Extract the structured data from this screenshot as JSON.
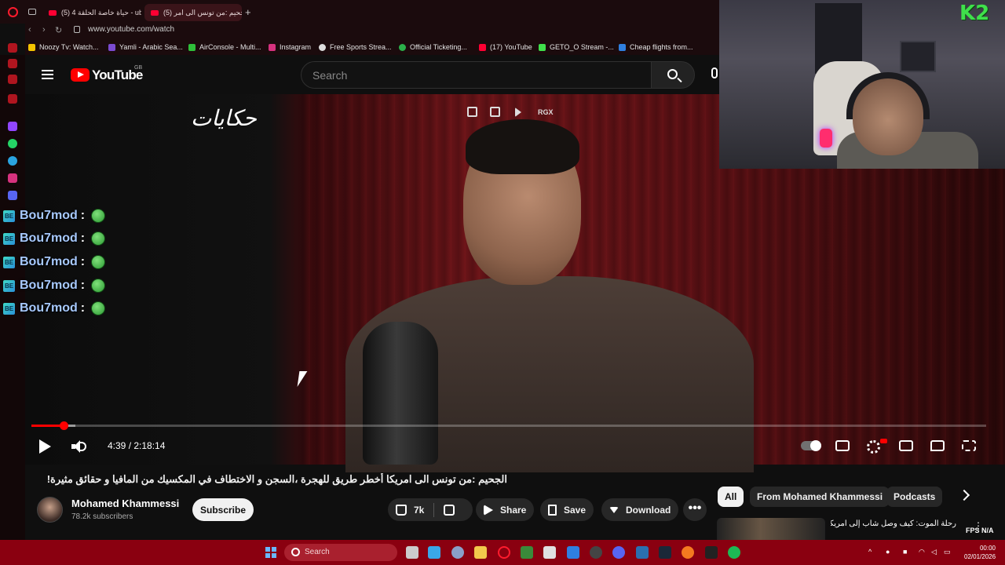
{
  "browser": {
    "tabs": [
      {
        "label": "(5) حياة خاصة الحلقة 4 - ube",
        "active": false
      },
      {
        "label": "(5) الجحيم :من تونس الى امر",
        "active": true
      }
    ],
    "url": "www.youtube.com/watch",
    "bookmarks": [
      {
        "label": "Noozy Tv: Watch...",
        "color": "#f5c400"
      },
      {
        "label": "Yamli - Arabic Sea...",
        "color": "#7b4bd1"
      },
      {
        "label": "AirConsole - Multi...",
        "color": "#2fbf3a"
      },
      {
        "label": "Instagram",
        "color": "#d6327e"
      },
      {
        "label": "Free Sports Strea...",
        "color": "#dddddd"
      },
      {
        "label": "Official Ticketing...",
        "color": "#2bb04a"
      },
      {
        "label": "(17) YouTube",
        "color": "#ff0033"
      },
      {
        "label": "GETO_O Stream -...",
        "color": "#3fe04b"
      },
      {
        "label": "Cheap flights from...",
        "color": "#2f7fe0"
      }
    ]
  },
  "youtube": {
    "logo_text": "YouTube",
    "region": "GB",
    "search_placeholder": "Search"
  },
  "video": {
    "channel_logo_text": "حكايات",
    "overlay_label": "RGX",
    "chat": [
      {
        "user": "Bou7mod",
        "badge": "BE"
      },
      {
        "user": "Bou7mod",
        "badge": "BE"
      },
      {
        "user": "Bou7mod",
        "badge": "BE"
      },
      {
        "user": "Bou7mod",
        "badge": "BE"
      },
      {
        "user": "Bou7mod",
        "badge": "BE"
      }
    ],
    "current_time": "4:39",
    "duration": "2:18:14",
    "time_display": "4:39 / 2:18:14",
    "played_fraction": 0.034,
    "buffered_fraction": 0.046,
    "hd_badge": "HD",
    "colors": {
      "progress": "#ff0000",
      "accent": "#ff0033"
    }
  },
  "webcam": {
    "overlay_logo": "K2"
  },
  "details": {
    "title": "الجحيم :من تونس الى امريكا أخطر طريق للهجرة ،السجن و الاختطاف في المكسيك من المافيا و حقائق مثيرة!",
    "channel": "Mohamed Khammessi",
    "subscribers": "78.2k subscribers",
    "subscribe_label": "Subscribe",
    "likes": "7k",
    "share_label": "Share",
    "save_label": "Save",
    "download_label": "Download",
    "more_label": "•••"
  },
  "recommendations": {
    "chips": [
      {
        "label": "All",
        "selected": true
      },
      {
        "label": "From Mohamed Khammessi",
        "selected": false
      },
      {
        "label": "Podcasts",
        "selected": false
      }
    ],
    "first_title": "رحلة الموت: كيف وصل شاب إلى امريكا"
  },
  "overlay_stats": "FPS N/A",
  "taskbar": {
    "search_label": "Search",
    "time": "00:00",
    "date": "02/01/2026"
  }
}
